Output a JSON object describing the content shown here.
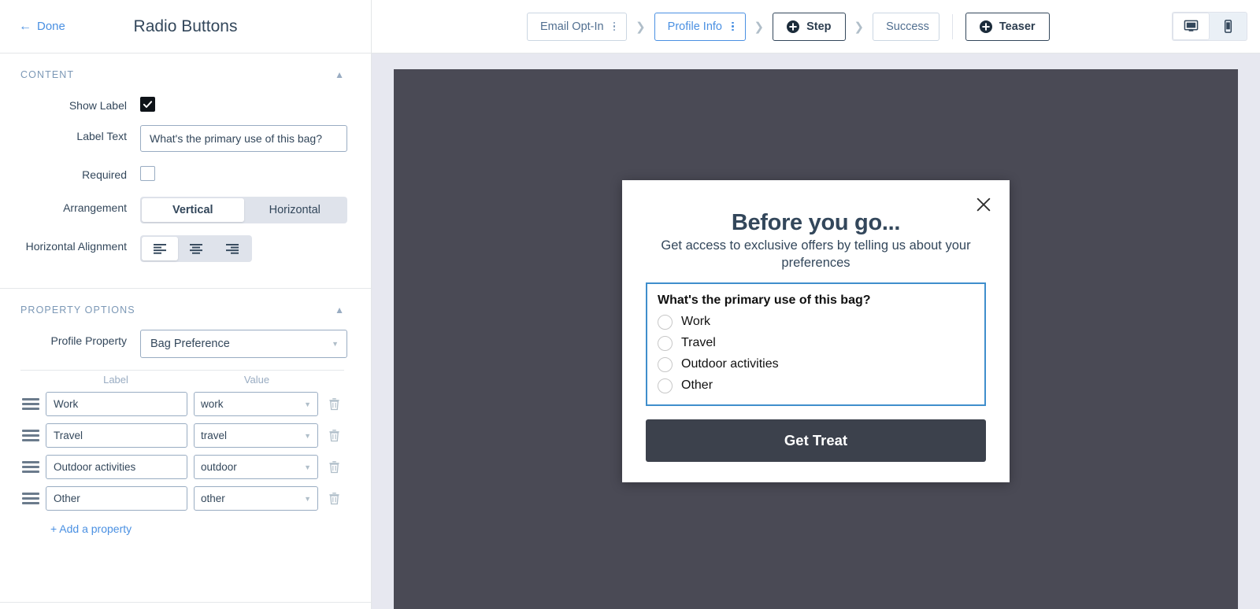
{
  "panel": {
    "done_label": "Done",
    "back_arrow_icon": "arrow-left-icon",
    "title": "Radio Buttons",
    "sections": [
      {
        "id": "content",
        "heading": "CONTENT",
        "collapse_icon": "chevron-up-icon",
        "fields": {
          "show_label": {
            "label": "Show Label",
            "checked": true
          },
          "label_text": {
            "label": "Label Text",
            "value": "What's the primary use of this bag?"
          },
          "required": {
            "label": "Required",
            "checked": false
          },
          "arrangement": {
            "label": "Arrangement",
            "options": [
              "Vertical",
              "Horizontal"
            ],
            "selected": "Vertical"
          },
          "horizontal_alignment": {
            "label": "Horizontal Alignment",
            "options": [
              "align-left-icon",
              "align-center-icon",
              "align-right-icon"
            ],
            "selected": "align-left-icon"
          }
        }
      },
      {
        "id": "property-options",
        "heading": "PROPERTY OPTIONS",
        "collapse_icon": "chevron-up-icon",
        "profile_property": {
          "label": "Profile Property",
          "value": "Bag Preference"
        },
        "table": {
          "columns": [
            "Label",
            "Value"
          ],
          "rows": [
            {
              "label": "Work",
              "value": "work"
            },
            {
              "label": "Travel",
              "value": "travel"
            },
            {
              "label": "Outdoor activities",
              "value": "outdoor"
            },
            {
              "label": "Other",
              "value": "other"
            }
          ]
        },
        "add_property_label": "+ Add a property"
      }
    ]
  },
  "toolbar": {
    "steps": [
      {
        "label": "Email Opt-In",
        "active": false
      },
      {
        "label": "Profile Info",
        "active": true
      },
      {
        "label": "Success",
        "active": false
      }
    ],
    "add_step_label": "Step",
    "teaser_label": "Teaser",
    "devices": [
      {
        "name": "desktop-view",
        "icon": "monitor-icon",
        "selected": true
      },
      {
        "name": "mobile-view",
        "icon": "phone-icon",
        "selected": false
      }
    ]
  },
  "preview": {
    "close_icon": "close-icon",
    "title": "Before you go...",
    "subtitle": "Get access to exclusive offers by telling us about your preferences",
    "question": "What's the primary use of this bag?",
    "options": [
      "Work",
      "Travel",
      "Outdoor activities",
      "Other"
    ],
    "cta_label": "Get Treat"
  },
  "colors": {
    "accent_blue": "#4a90e2",
    "selection_blue": "#3f8ecc",
    "stage_bg": "#4a4a55",
    "canvas_bg": "#e7e8f0",
    "cta_bg": "#3c414c"
  }
}
